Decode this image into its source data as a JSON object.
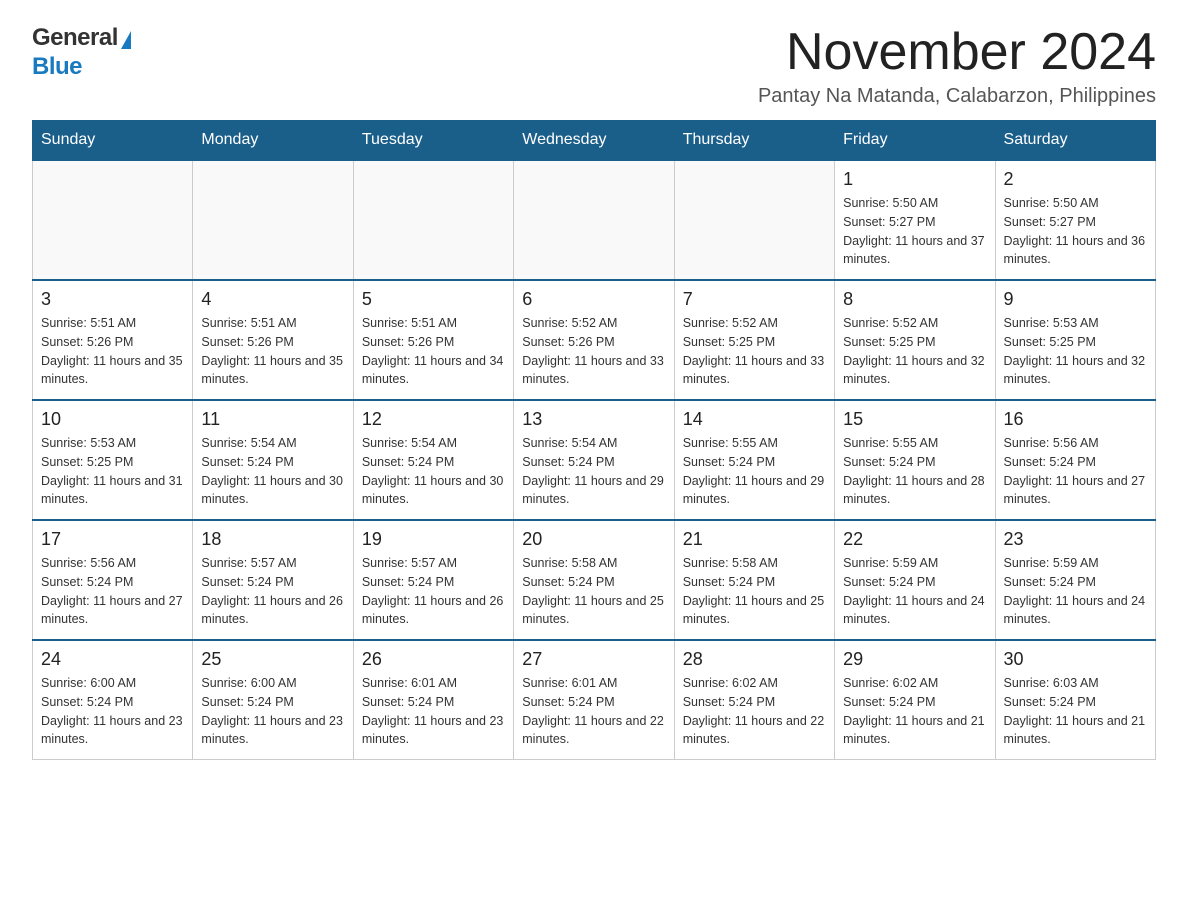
{
  "logo": {
    "general": "General",
    "blue": "Blue",
    "triangle": "▶"
  },
  "title": {
    "month_year": "November 2024",
    "location": "Pantay Na Matanda, Calabarzon, Philippines"
  },
  "header_days": [
    "Sunday",
    "Monday",
    "Tuesday",
    "Wednesday",
    "Thursday",
    "Friday",
    "Saturday"
  ],
  "weeks": [
    [
      {
        "day": "",
        "info": ""
      },
      {
        "day": "",
        "info": ""
      },
      {
        "day": "",
        "info": ""
      },
      {
        "day": "",
        "info": ""
      },
      {
        "day": "",
        "info": ""
      },
      {
        "day": "1",
        "info": "Sunrise: 5:50 AM\nSunset: 5:27 PM\nDaylight: 11 hours and 37 minutes."
      },
      {
        "day": "2",
        "info": "Sunrise: 5:50 AM\nSunset: 5:27 PM\nDaylight: 11 hours and 36 minutes."
      }
    ],
    [
      {
        "day": "3",
        "info": "Sunrise: 5:51 AM\nSunset: 5:26 PM\nDaylight: 11 hours and 35 minutes."
      },
      {
        "day": "4",
        "info": "Sunrise: 5:51 AM\nSunset: 5:26 PM\nDaylight: 11 hours and 35 minutes."
      },
      {
        "day": "5",
        "info": "Sunrise: 5:51 AM\nSunset: 5:26 PM\nDaylight: 11 hours and 34 minutes."
      },
      {
        "day": "6",
        "info": "Sunrise: 5:52 AM\nSunset: 5:26 PM\nDaylight: 11 hours and 33 minutes."
      },
      {
        "day": "7",
        "info": "Sunrise: 5:52 AM\nSunset: 5:25 PM\nDaylight: 11 hours and 33 minutes."
      },
      {
        "day": "8",
        "info": "Sunrise: 5:52 AM\nSunset: 5:25 PM\nDaylight: 11 hours and 32 minutes."
      },
      {
        "day": "9",
        "info": "Sunrise: 5:53 AM\nSunset: 5:25 PM\nDaylight: 11 hours and 32 minutes."
      }
    ],
    [
      {
        "day": "10",
        "info": "Sunrise: 5:53 AM\nSunset: 5:25 PM\nDaylight: 11 hours and 31 minutes."
      },
      {
        "day": "11",
        "info": "Sunrise: 5:54 AM\nSunset: 5:24 PM\nDaylight: 11 hours and 30 minutes."
      },
      {
        "day": "12",
        "info": "Sunrise: 5:54 AM\nSunset: 5:24 PM\nDaylight: 11 hours and 30 minutes."
      },
      {
        "day": "13",
        "info": "Sunrise: 5:54 AM\nSunset: 5:24 PM\nDaylight: 11 hours and 29 minutes."
      },
      {
        "day": "14",
        "info": "Sunrise: 5:55 AM\nSunset: 5:24 PM\nDaylight: 11 hours and 29 minutes."
      },
      {
        "day": "15",
        "info": "Sunrise: 5:55 AM\nSunset: 5:24 PM\nDaylight: 11 hours and 28 minutes."
      },
      {
        "day": "16",
        "info": "Sunrise: 5:56 AM\nSunset: 5:24 PM\nDaylight: 11 hours and 27 minutes."
      }
    ],
    [
      {
        "day": "17",
        "info": "Sunrise: 5:56 AM\nSunset: 5:24 PM\nDaylight: 11 hours and 27 minutes."
      },
      {
        "day": "18",
        "info": "Sunrise: 5:57 AM\nSunset: 5:24 PM\nDaylight: 11 hours and 26 minutes."
      },
      {
        "day": "19",
        "info": "Sunrise: 5:57 AM\nSunset: 5:24 PM\nDaylight: 11 hours and 26 minutes."
      },
      {
        "day": "20",
        "info": "Sunrise: 5:58 AM\nSunset: 5:24 PM\nDaylight: 11 hours and 25 minutes."
      },
      {
        "day": "21",
        "info": "Sunrise: 5:58 AM\nSunset: 5:24 PM\nDaylight: 11 hours and 25 minutes."
      },
      {
        "day": "22",
        "info": "Sunrise: 5:59 AM\nSunset: 5:24 PM\nDaylight: 11 hours and 24 minutes."
      },
      {
        "day": "23",
        "info": "Sunrise: 5:59 AM\nSunset: 5:24 PM\nDaylight: 11 hours and 24 minutes."
      }
    ],
    [
      {
        "day": "24",
        "info": "Sunrise: 6:00 AM\nSunset: 5:24 PM\nDaylight: 11 hours and 23 minutes."
      },
      {
        "day": "25",
        "info": "Sunrise: 6:00 AM\nSunset: 5:24 PM\nDaylight: 11 hours and 23 minutes."
      },
      {
        "day": "26",
        "info": "Sunrise: 6:01 AM\nSunset: 5:24 PM\nDaylight: 11 hours and 23 minutes."
      },
      {
        "day": "27",
        "info": "Sunrise: 6:01 AM\nSunset: 5:24 PM\nDaylight: 11 hours and 22 minutes."
      },
      {
        "day": "28",
        "info": "Sunrise: 6:02 AM\nSunset: 5:24 PM\nDaylight: 11 hours and 22 minutes."
      },
      {
        "day": "29",
        "info": "Sunrise: 6:02 AM\nSunset: 5:24 PM\nDaylight: 11 hours and 21 minutes."
      },
      {
        "day": "30",
        "info": "Sunrise: 6:03 AM\nSunset: 5:24 PM\nDaylight: 11 hours and 21 minutes."
      }
    ]
  ]
}
